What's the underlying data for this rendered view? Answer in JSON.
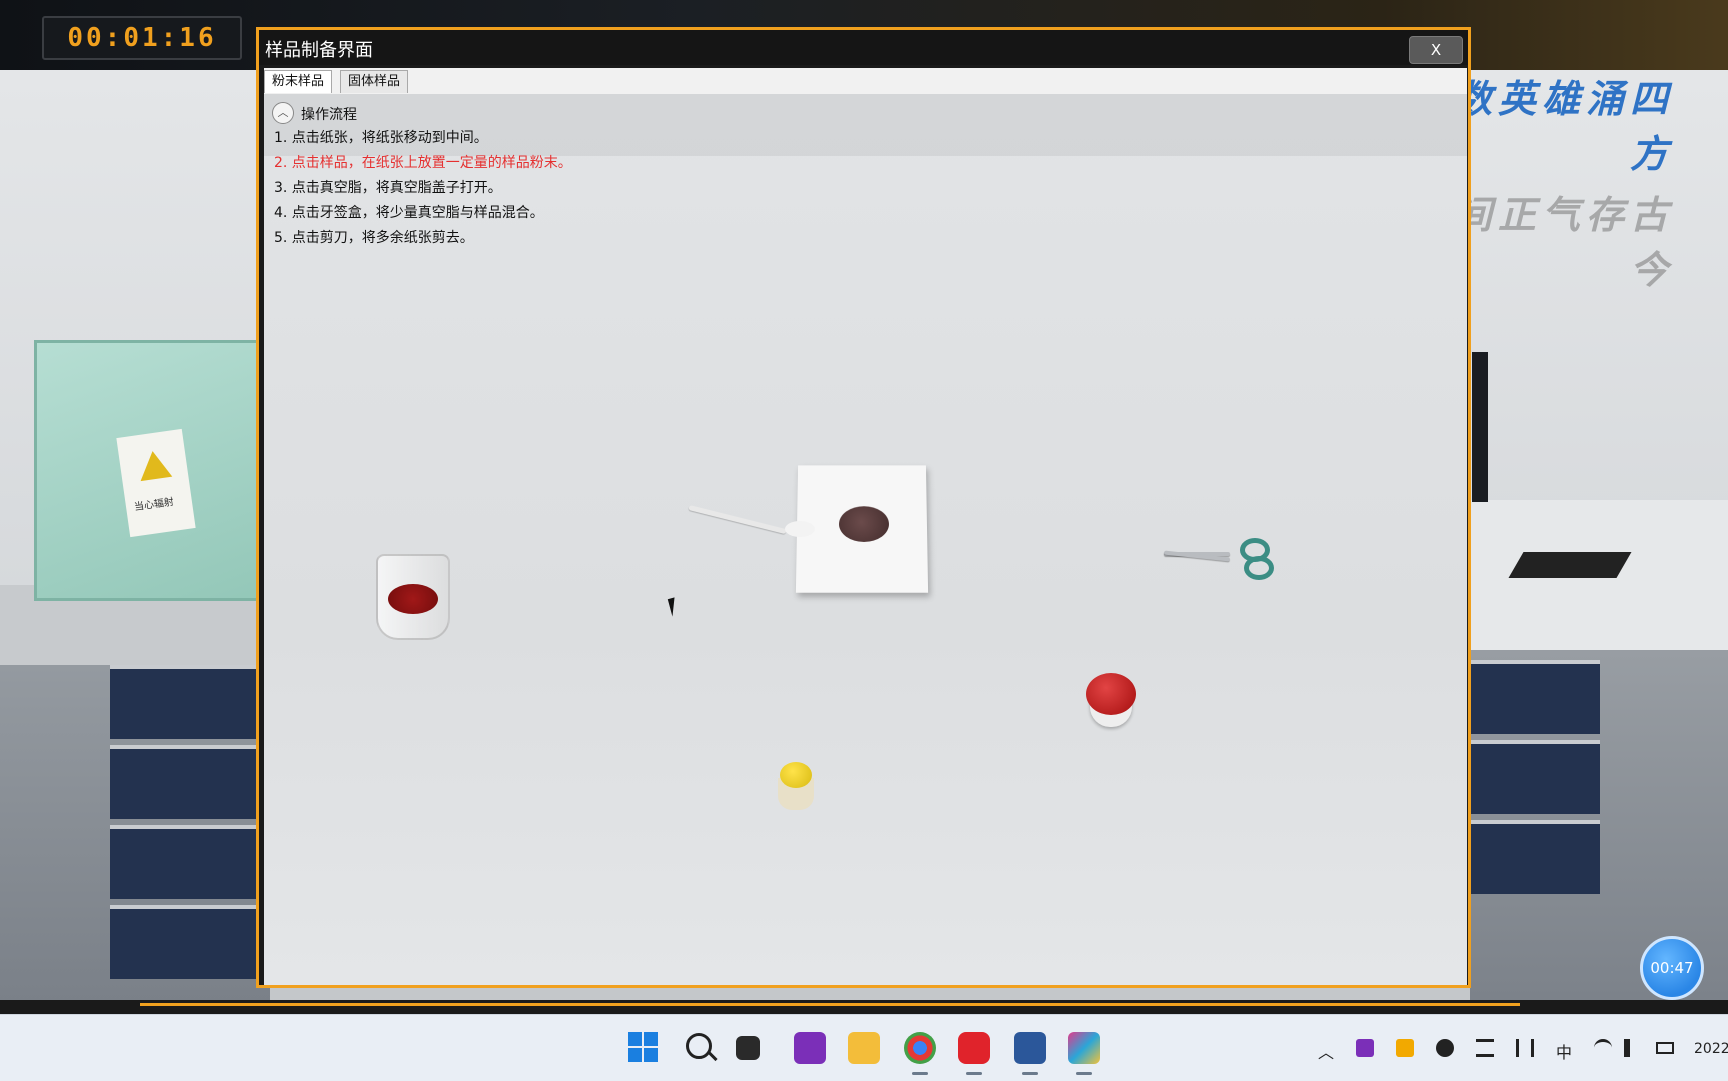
{
  "app": {
    "timer_top": "00:01:16",
    "corner_timer": "00:47",
    "calligraphy_line1": "无数英雄涌四方",
    "calligraphy_line2": "人间正气存古今"
  },
  "dialog": {
    "title": "样品制备界面",
    "close_label": "X",
    "tabs": [
      {
        "label": "粉末样品",
        "active": true
      },
      {
        "label": "固体样品",
        "active": false
      }
    ],
    "procedure": {
      "title": "操作流程",
      "current_step": 2,
      "steps": [
        "1. 点击纸张，将纸张移动到中间。",
        "2. 点击样品，在纸张上放置一定量的样品粉末。",
        "3. 点击真空脂，将真空脂盖子打开。",
        "4. 点击牙签盒，将少量真空脂与样品混合。",
        "5. 点击剪刀，将多余纸张剪去。"
      ]
    }
  },
  "scene": {
    "cabinet_label": "当心辐射"
  },
  "colors": {
    "accent": "#f0a01e",
    "current_step": "#e53030",
    "timer_digits": "#f0a01e"
  },
  "taskbar": {
    "tray_lang": "中",
    "tray_clock": "2022"
  }
}
